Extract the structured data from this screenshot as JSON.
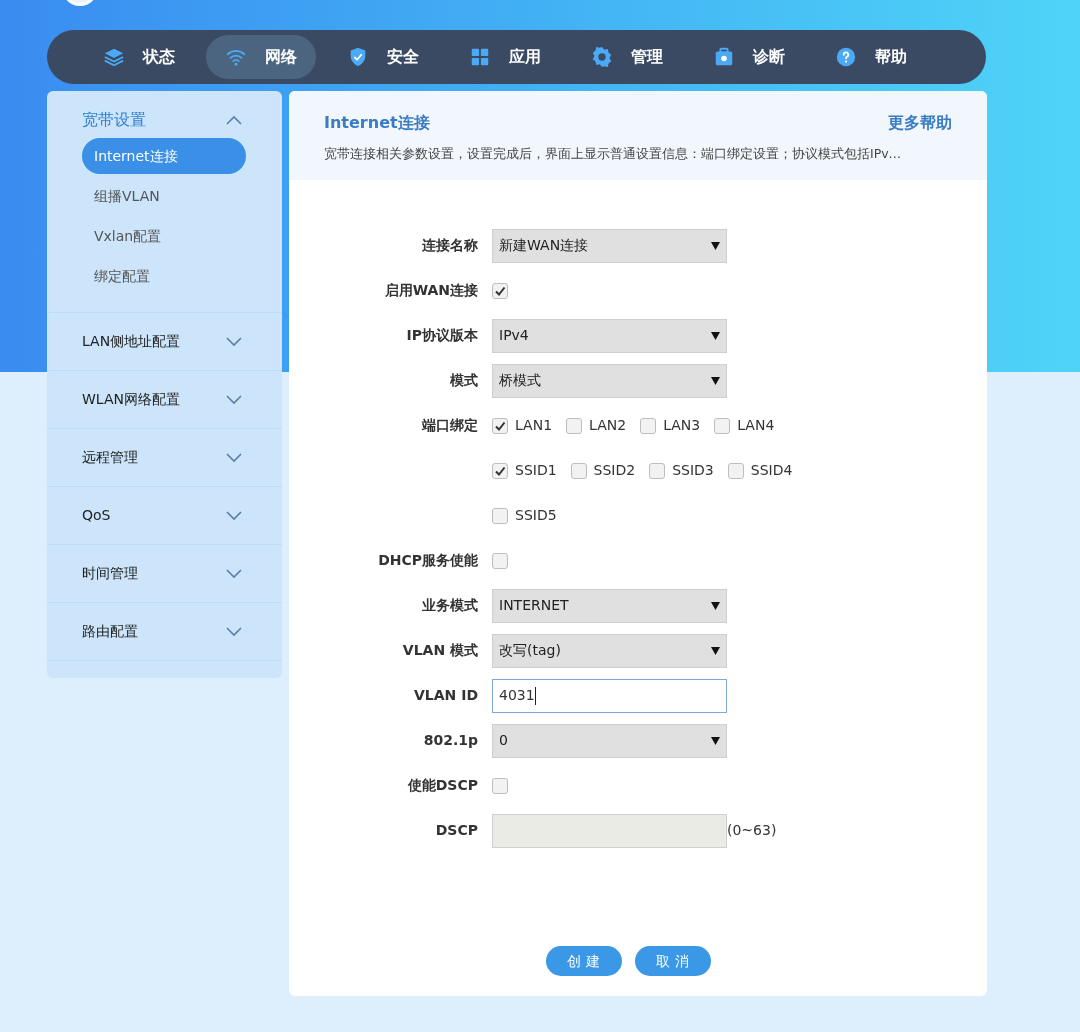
{
  "nav": [
    {
      "label": "状态",
      "selected": false
    },
    {
      "label": "网络",
      "selected": true
    },
    {
      "label": "安全",
      "selected": false
    },
    {
      "label": "应用",
      "selected": false
    },
    {
      "label": "管理",
      "selected": false
    },
    {
      "label": "诊断",
      "selected": false
    },
    {
      "label": "帮助",
      "selected": false
    }
  ],
  "sidebar": [
    {
      "label": "宽带设置",
      "expanded": true,
      "children": [
        {
          "label": "Internet连接",
          "selected": true
        },
        {
          "label": "组播VLAN",
          "selected": false
        },
        {
          "label": "Vxlan配置",
          "selected": false
        },
        {
          "label": "绑定配置",
          "selected": false
        }
      ]
    },
    {
      "label": "LAN侧地址配置",
      "expanded": false
    },
    {
      "label": "WLAN网络配置",
      "expanded": false
    },
    {
      "label": "远程管理",
      "expanded": false
    },
    {
      "label": "QoS",
      "expanded": false
    },
    {
      "label": "时间管理",
      "expanded": false
    },
    {
      "label": "路由配置",
      "expanded": false
    }
  ],
  "panel": {
    "title": "Internet连接",
    "help_link": "更多帮助",
    "description": "宽带连接相关参数设置，设置完成后，界面上显示普通设置信息：端口绑定设置；协议模式包括IPv…"
  },
  "form": [
    {
      "kind": "select",
      "label": "连接名称",
      "value": "新建WAN连接"
    },
    {
      "kind": "checkbox",
      "label": "启用WAN连接",
      "checked": true
    },
    {
      "kind": "select",
      "label": "IP协议版本",
      "value": "IPv4"
    },
    {
      "kind": "select",
      "label": "模式",
      "value": "桥模式"
    },
    {
      "kind": "checkgroup",
      "label": "端口绑定",
      "options": [
        {
          "label": "LAN1",
          "checked": true
        },
        {
          "label": "LAN2",
          "checked": false
        },
        {
          "label": "LAN3",
          "checked": false
        },
        {
          "label": "LAN4",
          "checked": false
        }
      ]
    },
    {
      "kind": "checkgroup",
      "options": [
        {
          "label": "SSID1",
          "checked": true
        },
        {
          "label": "SSID2",
          "checked": false
        },
        {
          "label": "SSID3",
          "checked": false
        },
        {
          "label": "SSID4",
          "checked": false
        }
      ]
    },
    {
      "kind": "checkgroup",
      "options": [
        {
          "label": "SSID5",
          "checked": false
        }
      ]
    },
    {
      "kind": "checkbox",
      "label": "DHCP服务使能",
      "checked": false
    },
    {
      "kind": "select",
      "label": "业务模式",
      "value": "INTERNET"
    },
    {
      "kind": "select",
      "label": "VLAN 模式",
      "value": "改写(tag)"
    },
    {
      "kind": "text",
      "label": "VLAN ID",
      "value": "4031",
      "focused": true
    },
    {
      "kind": "select",
      "label": "802.1p",
      "value": "0"
    },
    {
      "kind": "checkbox",
      "label": "使能DSCP",
      "checked": false
    },
    {
      "kind": "text",
      "label": "DSCP",
      "disabled": true,
      "hint": "(0~63)"
    }
  ],
  "buttons": [
    "创 建",
    "取 消"
  ]
}
